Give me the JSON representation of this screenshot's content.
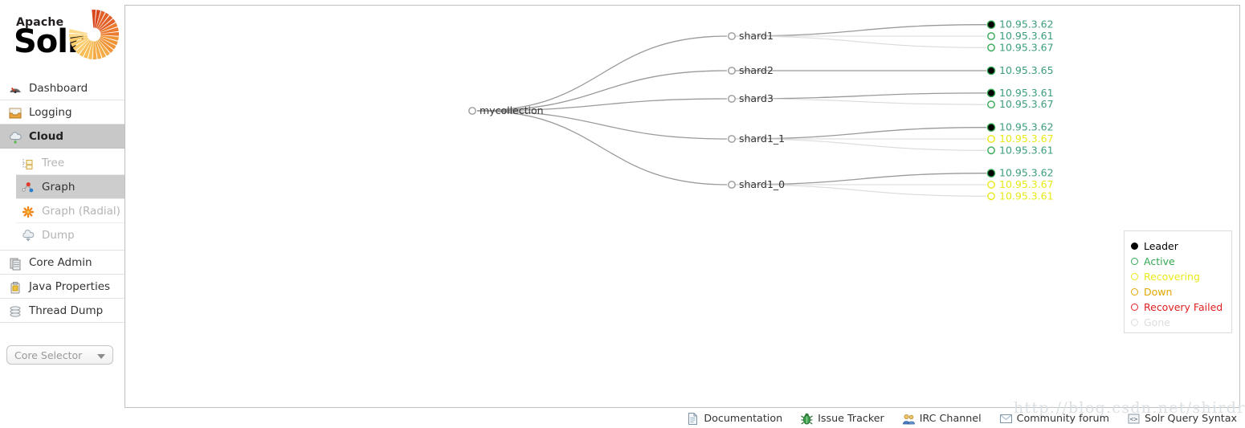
{
  "logo": {
    "apache": "Apache",
    "solr": "Solr"
  },
  "sidebar": {
    "items": [
      {
        "label": "Dashboard",
        "icon": "dashboard-gauge-icon"
      },
      {
        "label": "Logging",
        "icon": "logging-tray-icon"
      },
      {
        "label": "Cloud",
        "icon": "cloud-icon"
      }
    ],
    "sub_items": [
      {
        "label": "Tree",
        "icon": "tree-icon"
      },
      {
        "label": "Graph",
        "icon": "graph-icon"
      },
      {
        "label": "Graph (Radial)",
        "icon": "radial-asterisk-icon"
      },
      {
        "label": "Dump",
        "icon": "dump-cloud-icon"
      }
    ],
    "items_bottom": [
      {
        "label": "Core Admin",
        "icon": "core-admin-icon"
      },
      {
        "label": "Java Properties",
        "icon": "java-properties-icon"
      },
      {
        "label": "Thread Dump",
        "icon": "thread-dump-icon"
      }
    ],
    "core_selector": {
      "label": "Core Selector",
      "icon": "chevron-down-icon"
    }
  },
  "graph": {
    "root": "mycollection",
    "shards": [
      {
        "name": "shard1",
        "replicas": [
          {
            "ip": "10.95.3.62",
            "state": "leader"
          },
          {
            "ip": "10.95.3.61",
            "state": "active"
          },
          {
            "ip": "10.95.3.67",
            "state": "active"
          }
        ]
      },
      {
        "name": "shard2",
        "replicas": [
          {
            "ip": "10.95.3.65",
            "state": "leader"
          }
        ]
      },
      {
        "name": "shard3",
        "replicas": [
          {
            "ip": "10.95.3.61",
            "state": "leader"
          },
          {
            "ip": "10.95.3.67",
            "state": "active"
          }
        ]
      },
      {
        "name": "shard1_1",
        "replicas": [
          {
            "ip": "10.95.3.62",
            "state": "leader"
          },
          {
            "ip": "10.95.3.67",
            "state": "recovering"
          },
          {
            "ip": "10.95.3.61",
            "state": "active"
          }
        ]
      },
      {
        "name": "shard1_0",
        "replicas": [
          {
            "ip": "10.95.3.62",
            "state": "leader"
          },
          {
            "ip": "10.95.3.67",
            "state": "recovering"
          },
          {
            "ip": "10.95.3.61",
            "state": "recovering"
          }
        ]
      }
    ]
  },
  "legend": {
    "entries": [
      {
        "label": "Leader",
        "state": "leader"
      },
      {
        "label": "Active",
        "state": "active"
      },
      {
        "label": "Recovering",
        "state": "recovering"
      },
      {
        "label": "Down",
        "state": "down"
      },
      {
        "label": "Recovery Failed",
        "state": "failed"
      },
      {
        "label": "Gone",
        "state": "gone"
      }
    ]
  },
  "colors": {
    "leader": "#000000",
    "active": "#35a853",
    "recovering": "#e9e919",
    "down": "#e0a800",
    "failed": "#e02020",
    "gone": "#dcdcdc",
    "ip_active": "#3c9e7a",
    "ip_recovering": "#e9e919",
    "link": "#9a9a9a",
    "link_light": "#dadada"
  },
  "footer": {
    "links": [
      {
        "label": "Documentation",
        "icon": "document-icon"
      },
      {
        "label": "Issue Tracker",
        "icon": "bug-icon"
      },
      {
        "label": "IRC Channel",
        "icon": "people-icon"
      },
      {
        "label": "Community forum",
        "icon": "envelope-icon"
      },
      {
        "label": "Solr Query Syntax",
        "icon": "code-icon"
      }
    ]
  },
  "watermark": "http://blog.csdn.net/shirdrn"
}
